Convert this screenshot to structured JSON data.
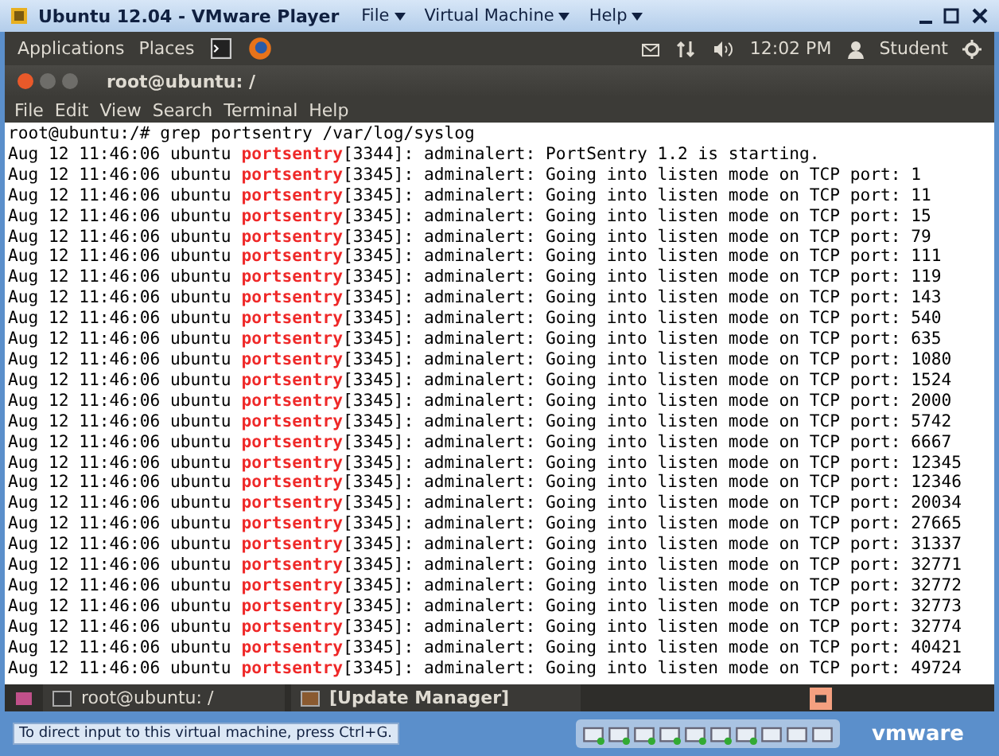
{
  "window": {
    "title": "Ubuntu 12.04 - VMware Player",
    "menus": [
      {
        "label": "File"
      },
      {
        "label": "Virtual Machine"
      },
      {
        "label": "Help"
      }
    ]
  },
  "top_panel": {
    "menus": [
      "Applications",
      "Places"
    ],
    "clock": "12:02 PM",
    "user": "Student"
  },
  "terminal": {
    "title": "root@ubuntu: /",
    "menus": [
      "File",
      "Edit",
      "View",
      "Search",
      "Terminal",
      "Help"
    ],
    "command": "root@ubuntu:/# grep portsentry /var/log/syslog",
    "lines": [
      {
        "stamp": "Aug 12 11:46:06 ubuntu",
        "process": "portsentry",
        "rest": "[3344]: adminalert: PortSentry 1.2 is starting."
      },
      {
        "stamp": "Aug 12 11:46:06 ubuntu",
        "process": "portsentry",
        "rest": "[3345]: adminalert: Going into listen mode on TCP port: 1"
      },
      {
        "stamp": "Aug 12 11:46:06 ubuntu",
        "process": "portsentry",
        "rest": "[3345]: adminalert: Going into listen mode on TCP port: 11"
      },
      {
        "stamp": "Aug 12 11:46:06 ubuntu",
        "process": "portsentry",
        "rest": "[3345]: adminalert: Going into listen mode on TCP port: 15"
      },
      {
        "stamp": "Aug 12 11:46:06 ubuntu",
        "process": "portsentry",
        "rest": "[3345]: adminalert: Going into listen mode on TCP port: 79"
      },
      {
        "stamp": "Aug 12 11:46:06 ubuntu",
        "process": "portsentry",
        "rest": "[3345]: adminalert: Going into listen mode on TCP port: 111"
      },
      {
        "stamp": "Aug 12 11:46:06 ubuntu",
        "process": "portsentry",
        "rest": "[3345]: adminalert: Going into listen mode on TCP port: 119"
      },
      {
        "stamp": "Aug 12 11:46:06 ubuntu",
        "process": "portsentry",
        "rest": "[3345]: adminalert: Going into listen mode on TCP port: 143"
      },
      {
        "stamp": "Aug 12 11:46:06 ubuntu",
        "process": "portsentry",
        "rest": "[3345]: adminalert: Going into listen mode on TCP port: 540"
      },
      {
        "stamp": "Aug 12 11:46:06 ubuntu",
        "process": "portsentry",
        "rest": "[3345]: adminalert: Going into listen mode on TCP port: 635"
      },
      {
        "stamp": "Aug 12 11:46:06 ubuntu",
        "process": "portsentry",
        "rest": "[3345]: adminalert: Going into listen mode on TCP port: 1080"
      },
      {
        "stamp": "Aug 12 11:46:06 ubuntu",
        "process": "portsentry",
        "rest": "[3345]: adminalert: Going into listen mode on TCP port: 1524"
      },
      {
        "stamp": "Aug 12 11:46:06 ubuntu",
        "process": "portsentry",
        "rest": "[3345]: adminalert: Going into listen mode on TCP port: 2000"
      },
      {
        "stamp": "Aug 12 11:46:06 ubuntu",
        "process": "portsentry",
        "rest": "[3345]: adminalert: Going into listen mode on TCP port: 5742"
      },
      {
        "stamp": "Aug 12 11:46:06 ubuntu",
        "process": "portsentry",
        "rest": "[3345]: adminalert: Going into listen mode on TCP port: 6667"
      },
      {
        "stamp": "Aug 12 11:46:06 ubuntu",
        "process": "portsentry",
        "rest": "[3345]: adminalert: Going into listen mode on TCP port: 12345"
      },
      {
        "stamp": "Aug 12 11:46:06 ubuntu",
        "process": "portsentry",
        "rest": "[3345]: adminalert: Going into listen mode on TCP port: 12346"
      },
      {
        "stamp": "Aug 12 11:46:06 ubuntu",
        "process": "portsentry",
        "rest": "[3345]: adminalert: Going into listen mode on TCP port: 20034"
      },
      {
        "stamp": "Aug 12 11:46:06 ubuntu",
        "process": "portsentry",
        "rest": "[3345]: adminalert: Going into listen mode on TCP port: 27665"
      },
      {
        "stamp": "Aug 12 11:46:06 ubuntu",
        "process": "portsentry",
        "rest": "[3345]: adminalert: Going into listen mode on TCP port: 31337"
      },
      {
        "stamp": "Aug 12 11:46:06 ubuntu",
        "process": "portsentry",
        "rest": "[3345]: adminalert: Going into listen mode on TCP port: 32771"
      },
      {
        "stamp": "Aug 12 11:46:06 ubuntu",
        "process": "portsentry",
        "rest": "[3345]: adminalert: Going into listen mode on TCP port: 32772"
      },
      {
        "stamp": "Aug 12 11:46:06 ubuntu",
        "process": "portsentry",
        "rest": "[3345]: adminalert: Going into listen mode on TCP port: 32773"
      },
      {
        "stamp": "Aug 12 11:46:06 ubuntu",
        "process": "portsentry",
        "rest": "[3345]: adminalert: Going into listen mode on TCP port: 32774"
      },
      {
        "stamp": "Aug 12 11:46:06 ubuntu",
        "process": "portsentry",
        "rest": "[3345]: adminalert: Going into listen mode on TCP port: 40421"
      },
      {
        "stamp": "Aug 12 11:46:06 ubuntu",
        "process": "portsentry",
        "rest": "[3345]: adminalert: Going into listen mode on TCP port: 49724"
      }
    ]
  },
  "taskbar": {
    "items": [
      {
        "label": "root@ubuntu: /",
        "bold": false
      },
      {
        "label": "[Update Manager]",
        "bold": true
      }
    ]
  },
  "status_bar": {
    "hint": "To direct input to this virtual machine, press Ctrl+G.",
    "logo": "vmware"
  }
}
